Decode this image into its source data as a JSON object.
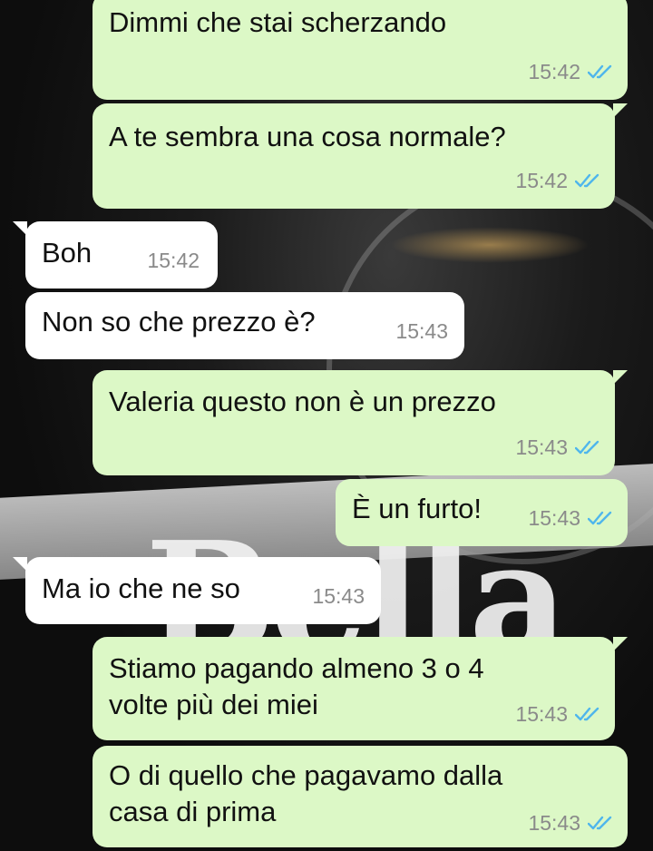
{
  "wallpaper_text": "Bella",
  "colors": {
    "outgoing_bubble": "#dcf8c6",
    "incoming_bubble": "#ffffff",
    "read_ticks": "#4fb6ec",
    "timestamp": "#8a8a8a"
  },
  "messages": [
    {
      "direction": "outgoing",
      "text": "Dimmi che stai scherzando",
      "time": "15:42",
      "status": "read-double-check-icon"
    },
    {
      "direction": "outgoing",
      "text": "A te sembra una cosa normale?",
      "time": "15:42",
      "status": "read-double-check-icon"
    },
    {
      "direction": "incoming",
      "text": "Boh",
      "time": "15:42"
    },
    {
      "direction": "incoming",
      "text": "Non so che prezzo è?",
      "time": "15:43"
    },
    {
      "direction": "outgoing",
      "text": "Valeria questo non è un prezzo",
      "time": "15:43",
      "status": "read-double-check-icon"
    },
    {
      "direction": "outgoing",
      "text": "È un furto!",
      "time": "15:43",
      "status": "read-double-check-icon"
    },
    {
      "direction": "incoming",
      "text": "Ma io che ne so",
      "time": "15:43"
    },
    {
      "direction": "outgoing",
      "text_line1": "Stiamo pagando almeno 3 o 4",
      "text_line2": "volte più dei miei",
      "time": "15:43",
      "status": "read-double-check-icon"
    },
    {
      "direction": "outgoing",
      "text_line1": "O di quello che pagavamo dalla",
      "text_line2": "casa di prima",
      "time": "15:43",
      "status": "read-double-check-icon"
    }
  ]
}
